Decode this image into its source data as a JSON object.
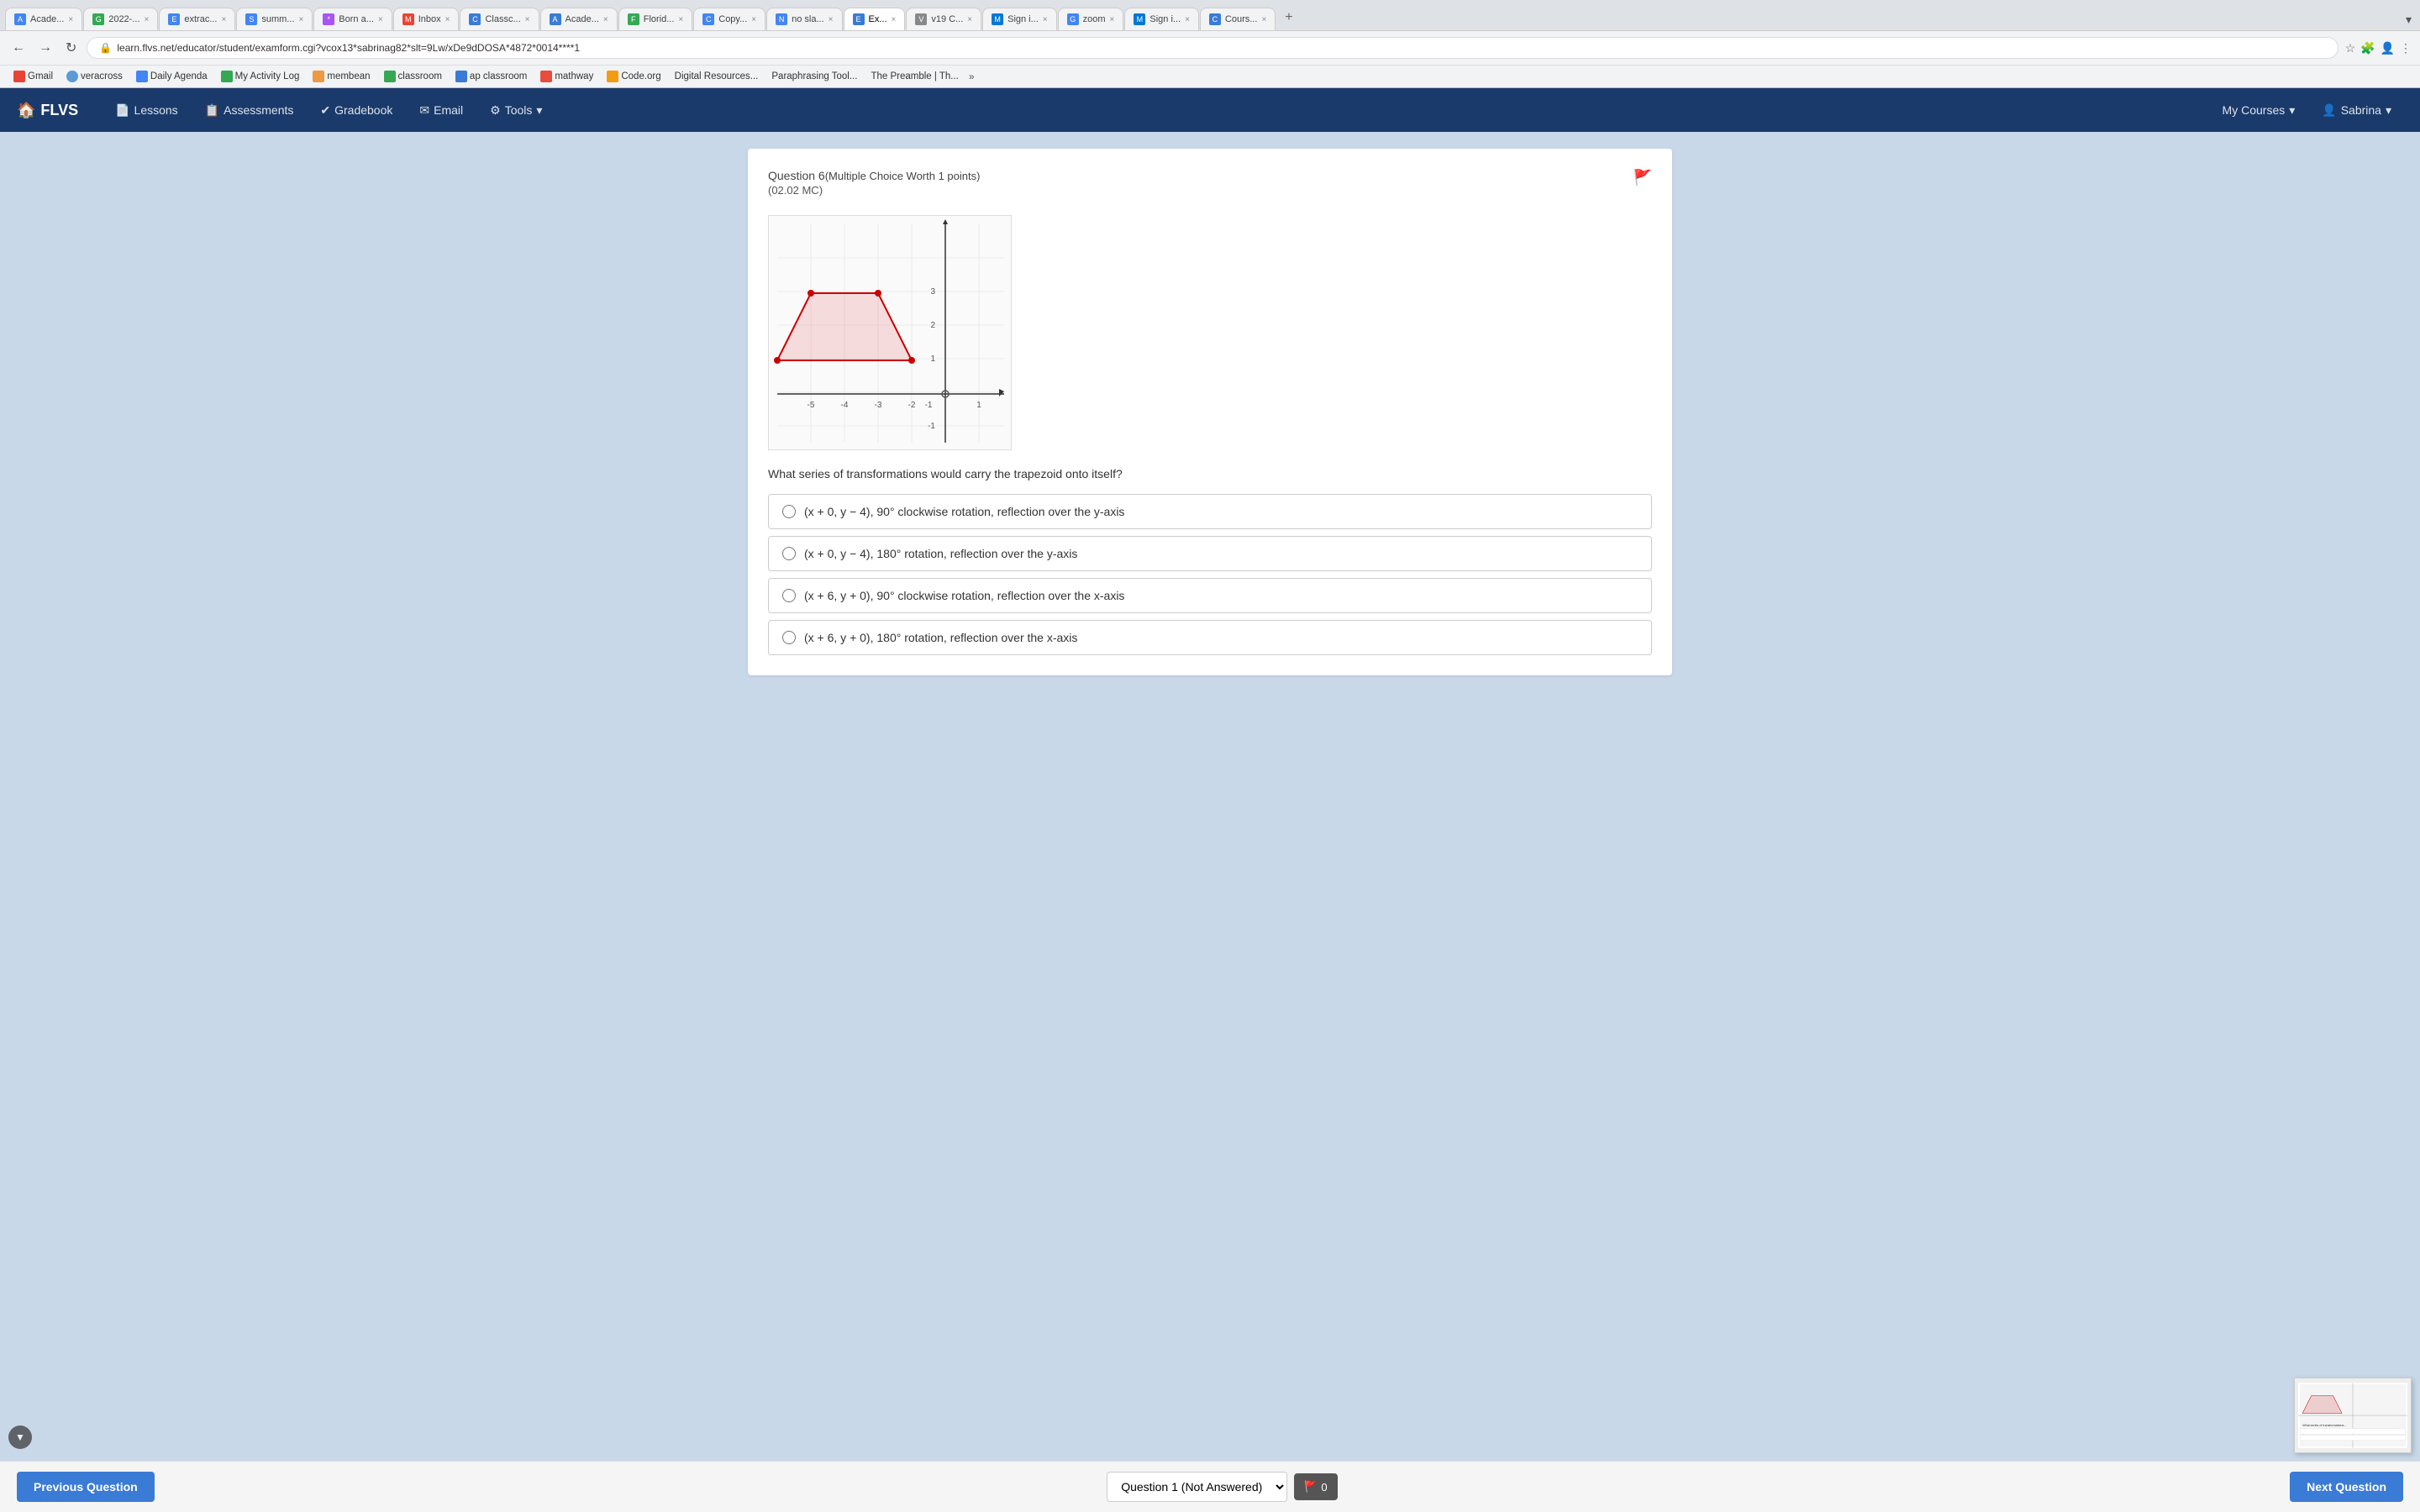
{
  "browser": {
    "tabs": [
      {
        "id": 1,
        "favicon_color": "#4285f4",
        "favicon_letter": "A",
        "title": "Acade...",
        "active": false
      },
      {
        "id": 2,
        "favicon_color": "#34a853",
        "favicon_letter": "G",
        "title": "2022-...",
        "active": false
      },
      {
        "id": 3,
        "favicon_color": "#4285f4",
        "favicon_letter": "E",
        "title": "extrac...",
        "active": false
      },
      {
        "id": 4,
        "favicon_color": "#4285f4",
        "favicon_letter": "S",
        "title": "summ...",
        "active": false
      },
      {
        "id": 5,
        "favicon_color": "#a855f7",
        "favicon_letter": "*",
        "title": "Born a...",
        "active": false
      },
      {
        "id": 6,
        "favicon_color": "#ea4335",
        "favicon_letter": "M",
        "title": "Inbox",
        "active": false
      },
      {
        "id": 7,
        "favicon_color": "#3a7bd5",
        "favicon_letter": "C",
        "title": "Classc...",
        "active": false
      },
      {
        "id": 8,
        "favicon_color": "#3a7bd5",
        "favicon_letter": "A",
        "title": "Acade...",
        "active": false
      },
      {
        "id": 9,
        "favicon_color": "#34a853",
        "favicon_letter": "F",
        "title": "Florid...",
        "active": false
      },
      {
        "id": 10,
        "favicon_color": "#4285f4",
        "favicon_letter": "C",
        "title": "Copy ...",
        "active": false
      },
      {
        "id": 11,
        "favicon_color": "#4285f4",
        "favicon_letter": "N",
        "title": "no sla...",
        "active": false
      },
      {
        "id": 12,
        "favicon_color": "#3a7bd5",
        "favicon_letter": "E",
        "title": "Ex...",
        "active": true
      },
      {
        "id": 13,
        "favicon_color": "#888",
        "favicon_letter": "V",
        "title": "v19 C...",
        "active": false
      },
      {
        "id": 14,
        "favicon_color": "#0078d4",
        "favicon_letter": "M",
        "title": "Sign i...",
        "active": false
      },
      {
        "id": 15,
        "favicon_color": "#4285f4",
        "favicon_letter": "G",
        "title": "zoom",
        "active": false
      },
      {
        "id": 16,
        "favicon_color": "#0078d4",
        "favicon_letter": "M",
        "title": "Sign i...",
        "active": false
      },
      {
        "id": 17,
        "favicon_color": "#3a7bd5",
        "favicon_letter": "C",
        "title": "Cours...",
        "active": false
      }
    ],
    "url": "learn.flvs.net/educator/student/examform.cgi?vcox13*sabrinag82*slt=9Lw/xDe9dDOSA*4872*0014****1"
  },
  "bookmarks": [
    {
      "label": "Gmail",
      "icon_color": "#ea4335"
    },
    {
      "label": "veracross",
      "icon_color": "#5b9bd5"
    },
    {
      "label": "Daily Agenda",
      "icon_color": "#4285f4"
    },
    {
      "label": "My Activity Log",
      "icon_color": "#34a853"
    },
    {
      "label": "membean",
      "icon_color": "#f4a"
    },
    {
      "label": "classroom",
      "icon_color": "#34a853"
    },
    {
      "label": "ap classroom",
      "icon_color": "#3a7bd5"
    },
    {
      "label": "mathway",
      "icon_color": "#e74c3c"
    },
    {
      "label": "Code.org",
      "icon_color": "#f39c12"
    },
    {
      "label": "Digital Resources...",
      "icon_color": "#999"
    },
    {
      "label": "Paraphrasing Tool...",
      "icon_color": "#999"
    },
    {
      "label": "The Preamble | Th...",
      "icon_color": "#999"
    }
  ],
  "nav": {
    "logo": "FLVS",
    "logo_icon": "🏠",
    "items": [
      {
        "label": "Lessons",
        "icon": "📄"
      },
      {
        "label": "Assessments",
        "icon": "📋"
      },
      {
        "label": "Gradebook",
        "icon": "✔"
      },
      {
        "label": "Email",
        "icon": "✉"
      },
      {
        "label": "Tools",
        "icon": "⚙",
        "dropdown": true
      }
    ],
    "right_items": [
      {
        "label": "My Courses",
        "dropdown": true
      },
      {
        "label": "Sabrina",
        "icon": "👤",
        "dropdown": true
      }
    ]
  },
  "question": {
    "number": "Question 6",
    "meta": "(Multiple Choice Worth 1 points)",
    "code": "(02.02 MC)",
    "text": "What series of transformations would carry the trapezoid onto itself?",
    "answers": [
      {
        "id": "a",
        "text": "(x + 0, y − 4), 90° clockwise rotation, reflection over the y-axis"
      },
      {
        "id": "b",
        "text": "(x + 0, y − 4), 180° rotation, reflection over the y-axis"
      },
      {
        "id": "c",
        "text": "(x + 6, y + 0), 90° clockwise rotation, reflection over the x-axis"
      },
      {
        "id": "d",
        "text": "(x + 6, y + 0), 180° rotation, reflection over the x-axis"
      }
    ]
  },
  "bottom_nav": {
    "prev_button": "Previous Question",
    "next_button": "Next Question",
    "question_dropdown_value": "Question 1 (Not Answered)",
    "flag_count": "0",
    "flag_icon": "🚩"
  }
}
